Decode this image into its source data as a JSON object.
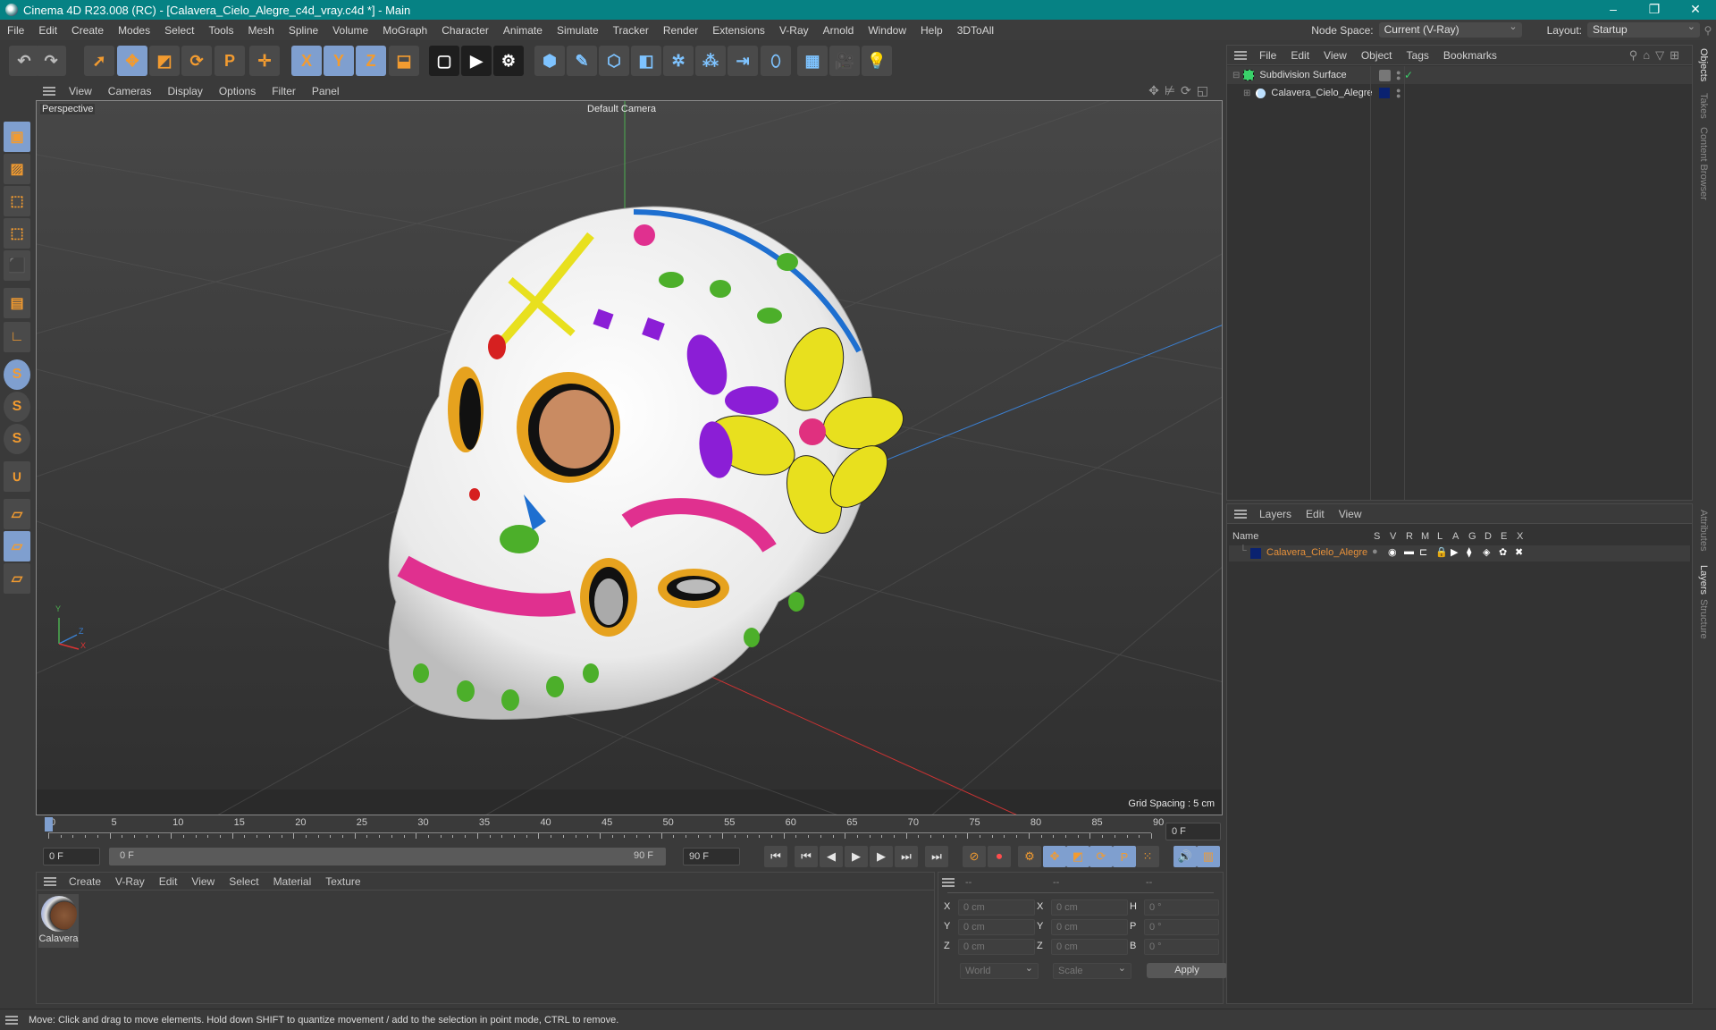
{
  "window": {
    "title": "Cinema 4D R23.008 (RC) - [Calavera_Cielo_Alegre_c4d_vray.c4d *] - Main",
    "controls": [
      "minimize",
      "restore",
      "close"
    ]
  },
  "menubar": {
    "items": [
      "File",
      "Edit",
      "Create",
      "Modes",
      "Select",
      "Tools",
      "Mesh",
      "Spline",
      "Volume",
      "MoGraph",
      "Character",
      "Animate",
      "Simulate",
      "Tracker",
      "Render",
      "Extensions",
      "V-Ray",
      "Arnold",
      "Window",
      "Help",
      "3DToAll"
    ],
    "node_space_label": "Node Space:",
    "node_space_value": "Current (V-Ray)",
    "layout_label": "Layout:",
    "layout_value": "Startup"
  },
  "toolbar": {
    "tools": [
      {
        "name": "undo-icon",
        "glyph": "↶"
      },
      {
        "name": "redo-icon",
        "glyph": "↷"
      },
      {
        "name": "select-icon",
        "glyph": "➚"
      },
      {
        "name": "move-icon",
        "glyph": "✥"
      },
      {
        "name": "scale-icon",
        "glyph": "◩"
      },
      {
        "name": "rotate-icon",
        "glyph": "⟳"
      },
      {
        "name": "psr-icon",
        "glyph": "P"
      },
      {
        "name": "transform-icon",
        "glyph": "✛"
      },
      {
        "name": "x-axis-icon",
        "glyph": "X"
      },
      {
        "name": "y-axis-icon",
        "glyph": "Y"
      },
      {
        "name": "z-axis-icon",
        "glyph": "Z"
      },
      {
        "name": "coordinate-system-icon",
        "glyph": "⬓"
      },
      {
        "name": "render-region-icon",
        "glyph": "▢"
      },
      {
        "name": "render-view-icon",
        "glyph": "▶"
      },
      {
        "name": "render-settings-icon",
        "glyph": "⚙"
      },
      {
        "name": "cube-icon",
        "glyph": "⬢"
      },
      {
        "name": "pen-icon",
        "glyph": "✎"
      },
      {
        "name": "subdivision-icon",
        "glyph": "⬡"
      },
      {
        "name": "extrude-icon",
        "glyph": "◧"
      },
      {
        "name": "cloner-icon",
        "glyph": "✲"
      },
      {
        "name": "array-icon",
        "glyph": "⁂"
      },
      {
        "name": "deformer-icon",
        "glyph": "⇥"
      },
      {
        "name": "field-icon",
        "glyph": "⬯"
      },
      {
        "name": "floor-icon",
        "glyph": "▦"
      },
      {
        "name": "camera-icon",
        "glyph": "🎥"
      },
      {
        "name": "light-icon",
        "glyph": "💡"
      }
    ]
  },
  "left_tools": [
    {
      "name": "model-mode-icon",
      "glyph": "▣"
    },
    {
      "name": "texture-mode-icon",
      "glyph": "▨"
    },
    {
      "name": "points-mode-icon",
      "glyph": "⬚"
    },
    {
      "name": "edges-mode-icon",
      "glyph": "⬚"
    },
    {
      "name": "polygons-mode-icon",
      "glyph": "⬛"
    },
    {
      "name": "uv-mode-icon",
      "glyph": "▤"
    },
    {
      "name": "axis-mode-icon",
      "glyph": "∟"
    },
    {
      "name": "snap-icon",
      "glyph": "S"
    },
    {
      "name": "snap-settings-icon",
      "glyph": "S"
    },
    {
      "name": "snap-3d-icon",
      "glyph": "S"
    },
    {
      "name": "magnet-icon",
      "glyph": "∪"
    },
    {
      "name": "workplane-icon",
      "glyph": "▱"
    },
    {
      "name": "workplane-lock-icon",
      "glyph": "▱"
    },
    {
      "name": "workplane-align-icon",
      "glyph": "▱"
    }
  ],
  "viewport": {
    "menu": [
      "View",
      "Cameras",
      "Display",
      "Options",
      "Filter",
      "Panel"
    ],
    "projection": "Perspective",
    "camera": "Default Camera",
    "grid_spacing": "Grid Spacing : 5 cm",
    "axis_labels": {
      "x": "X",
      "y": "Y",
      "z": "Z"
    },
    "nav_icons": [
      "move-view-icon",
      "zoom-view-icon",
      "rotate-view-icon",
      "toggle-layout-icon"
    ]
  },
  "timeline": {
    "ticks": [
      "0",
      "5",
      "10",
      "15",
      "20",
      "25",
      "30",
      "35",
      "40",
      "45",
      "50",
      "55",
      "60",
      "65",
      "70",
      "75",
      "80",
      "85",
      "90"
    ],
    "current_frame": "0 F",
    "end_frame_display": "0 F",
    "start_field": "0 F",
    "range_start": "0 F",
    "range_end": "90 F",
    "end_field": "90 F",
    "playhead_frame": 0,
    "max_frame": 90
  },
  "playback": {
    "buttons": [
      {
        "name": "go-to-start-icon",
        "glyph": "⏮"
      },
      {
        "name": "prev-key-icon",
        "glyph": "⏮"
      },
      {
        "name": "prev-frame-icon",
        "glyph": "◀"
      },
      {
        "name": "play-icon",
        "glyph": "▶"
      },
      {
        "name": "next-frame-icon",
        "glyph": "▶"
      },
      {
        "name": "next-key-icon",
        "glyph": "⏭"
      },
      {
        "name": "go-to-end-icon",
        "glyph": "⏭"
      },
      {
        "name": "record-keys-icon",
        "glyph": "⊘"
      },
      {
        "name": "autokey-icon",
        "glyph": "⏺"
      },
      {
        "name": "keyframe-selection-icon",
        "glyph": "⚙"
      },
      {
        "name": "key-position-icon",
        "glyph": "✥"
      },
      {
        "name": "key-scale-icon",
        "glyph": "◩"
      },
      {
        "name": "key-rotation-icon",
        "glyph": "⟳"
      },
      {
        "name": "key-param-icon",
        "glyph": "P"
      },
      {
        "name": "key-pla-icon",
        "glyph": "⁙"
      },
      {
        "name": "sound-icon",
        "glyph": "🔊"
      },
      {
        "name": "timeline-settings-icon",
        "glyph": "▥"
      }
    ]
  },
  "materials": {
    "menu": [
      "Create",
      "V-Ray",
      "Edit",
      "View",
      "Select",
      "Material",
      "Texture"
    ],
    "items": [
      {
        "name": "Calavera"
      }
    ]
  },
  "coordinates": {
    "headers": [
      "--",
      "--",
      "--"
    ],
    "rows": [
      {
        "l1": "X",
        "v1": "0 cm",
        "l2": "X",
        "v2": "0 cm",
        "l3": "H",
        "v3": "0 °"
      },
      {
        "l1": "Y",
        "v1": "0 cm",
        "l2": "Y",
        "v2": "0 cm",
        "l3": "P",
        "v3": "0 °"
      },
      {
        "l1": "Z",
        "v1": "0 cm",
        "l2": "Z",
        "v2": "0 cm",
        "l3": "B",
        "v3": "0 °"
      }
    ],
    "space": "World",
    "mode": "Scale",
    "apply": "Apply"
  },
  "objects": {
    "menu": [
      "File",
      "Edit",
      "View",
      "Object",
      "Tags",
      "Bookmarks"
    ],
    "tree": [
      {
        "name": "Subdivision Surface",
        "level": 0
      },
      {
        "name": "Calavera_Cielo_Alegre",
        "level": 1,
        "layer_color": "#0a2270"
      }
    ]
  },
  "layers": {
    "menu": [
      "Layers",
      "Edit",
      "View"
    ],
    "columns": [
      "Name",
      "S",
      "V",
      "R",
      "M",
      "L",
      "A",
      "G",
      "D",
      "E",
      "X"
    ],
    "rows": [
      {
        "name": "Calavera_Cielo_Alegre",
        "color": "#0a2270",
        "text_color": "#e8913a"
      }
    ]
  },
  "side_tabs": {
    "top": [
      "Objects",
      "Takes",
      "Content Browser"
    ],
    "bottom": [
      "Attributes",
      "Layers",
      "Structure"
    ]
  },
  "status": "Move: Click and drag to move elements. Hold down SHIFT to quantize movement / add to the selection in point mode, CTRL to remove.",
  "colors": {
    "accent": "#f29b30",
    "selected": "#7f9fcf",
    "titlebar": "#068284"
  }
}
